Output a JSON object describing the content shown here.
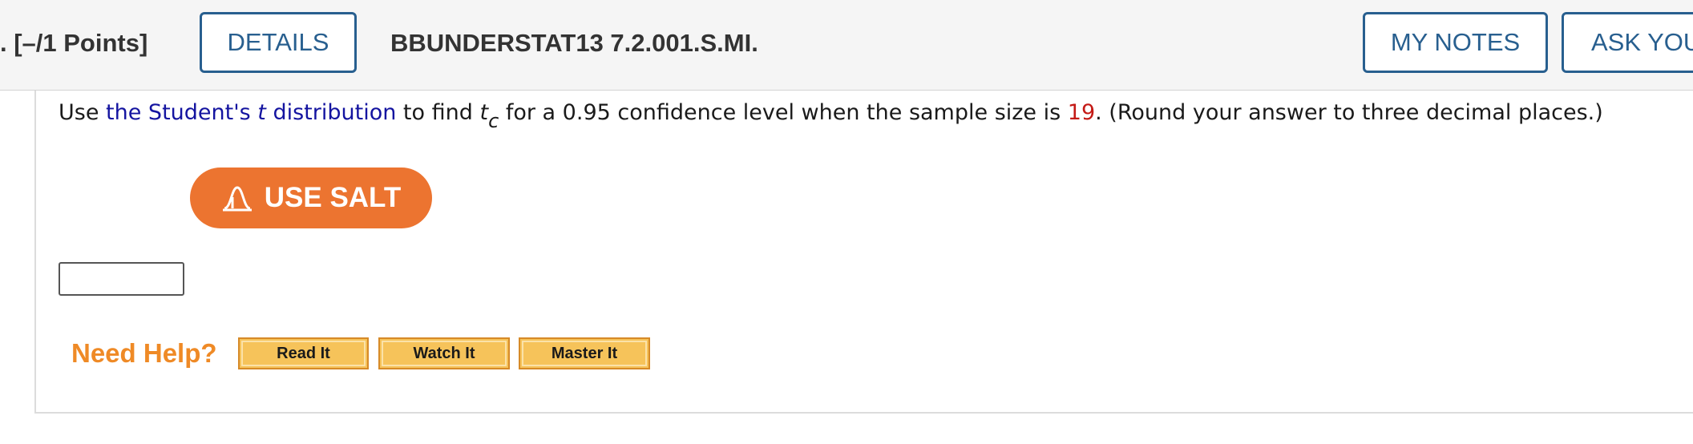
{
  "header": {
    "points_label": ". [–/1 Points]",
    "details_label": "DETAILS",
    "question_id": "BBUNDERSTAT13 7.2.001.S.MI.",
    "my_notes_label": "MY NOTES",
    "ask_label": "ASK YOUR"
  },
  "question": {
    "part1": "Use ",
    "link_text_a": "the Student's ",
    "link_text_t": "t",
    "link_text_b": " distribution",
    "part2": " to find ",
    "t": "t",
    "sub_c": "c",
    "part3": " for a 0.95 confidence level when the sample size is ",
    "sample_size": "19",
    "part4": ". (Round your answer to three decimal places.)"
  },
  "salt": {
    "label": "USE SALT",
    "icon": "bell-curve-icon"
  },
  "answer": {
    "value": ""
  },
  "help": {
    "label": "Need Help?",
    "buttons": [
      "Read It",
      "Watch It",
      "Master It"
    ]
  },
  "colors": {
    "accent_blue": "#285f8f",
    "link": "#1414a0",
    "highlight_red": "#c41a16",
    "salt_orange": "#ec7430",
    "help_orange": "#ef8a26",
    "help_button": "#f6c35a"
  }
}
